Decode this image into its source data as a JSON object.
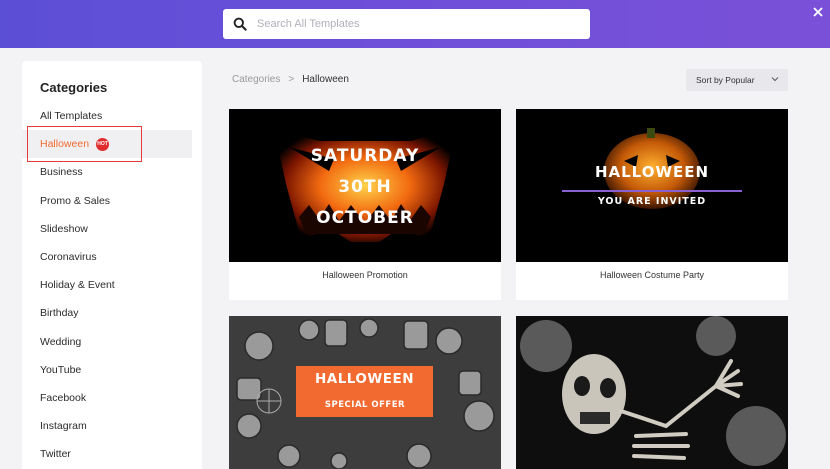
{
  "search": {
    "placeholder": "Search All Templates"
  },
  "sidebar": {
    "title": "Categories",
    "items": [
      {
        "label": "All Templates"
      },
      {
        "label": "Halloween",
        "badge": "HOT"
      },
      {
        "label": "Business"
      },
      {
        "label": "Promo & Sales"
      },
      {
        "label": "Slideshow"
      },
      {
        "label": "Coronavirus"
      },
      {
        "label": "Holiday & Event"
      },
      {
        "label": "Birthday"
      },
      {
        "label": "Wedding"
      },
      {
        "label": "YouTube"
      },
      {
        "label": "Facebook"
      },
      {
        "label": "Instagram"
      },
      {
        "label": "Twitter"
      }
    ]
  },
  "breadcrumb": {
    "root": "Categories",
    "separator": ">",
    "current": "Halloween"
  },
  "sort": {
    "label": "Sort by Popular"
  },
  "templates": [
    {
      "name": "Halloween Promotion",
      "art_lines": [
        "SATURDAY",
        "30TH",
        "OCTOBER"
      ]
    },
    {
      "name": "Halloween Costume Party",
      "art_lines": [
        "HALLOWEEN",
        "YOU ARE INVITED"
      ]
    },
    {
      "name": "",
      "art_lines": [
        "HALLOWEEN",
        "SPECIAL OFFER"
      ]
    },
    {
      "name": "",
      "art_lines": []
    }
  ],
  "colors": {
    "accent": "#f26a2f",
    "topbar": "#6a4fd8",
    "hot": "#e02d2d"
  }
}
